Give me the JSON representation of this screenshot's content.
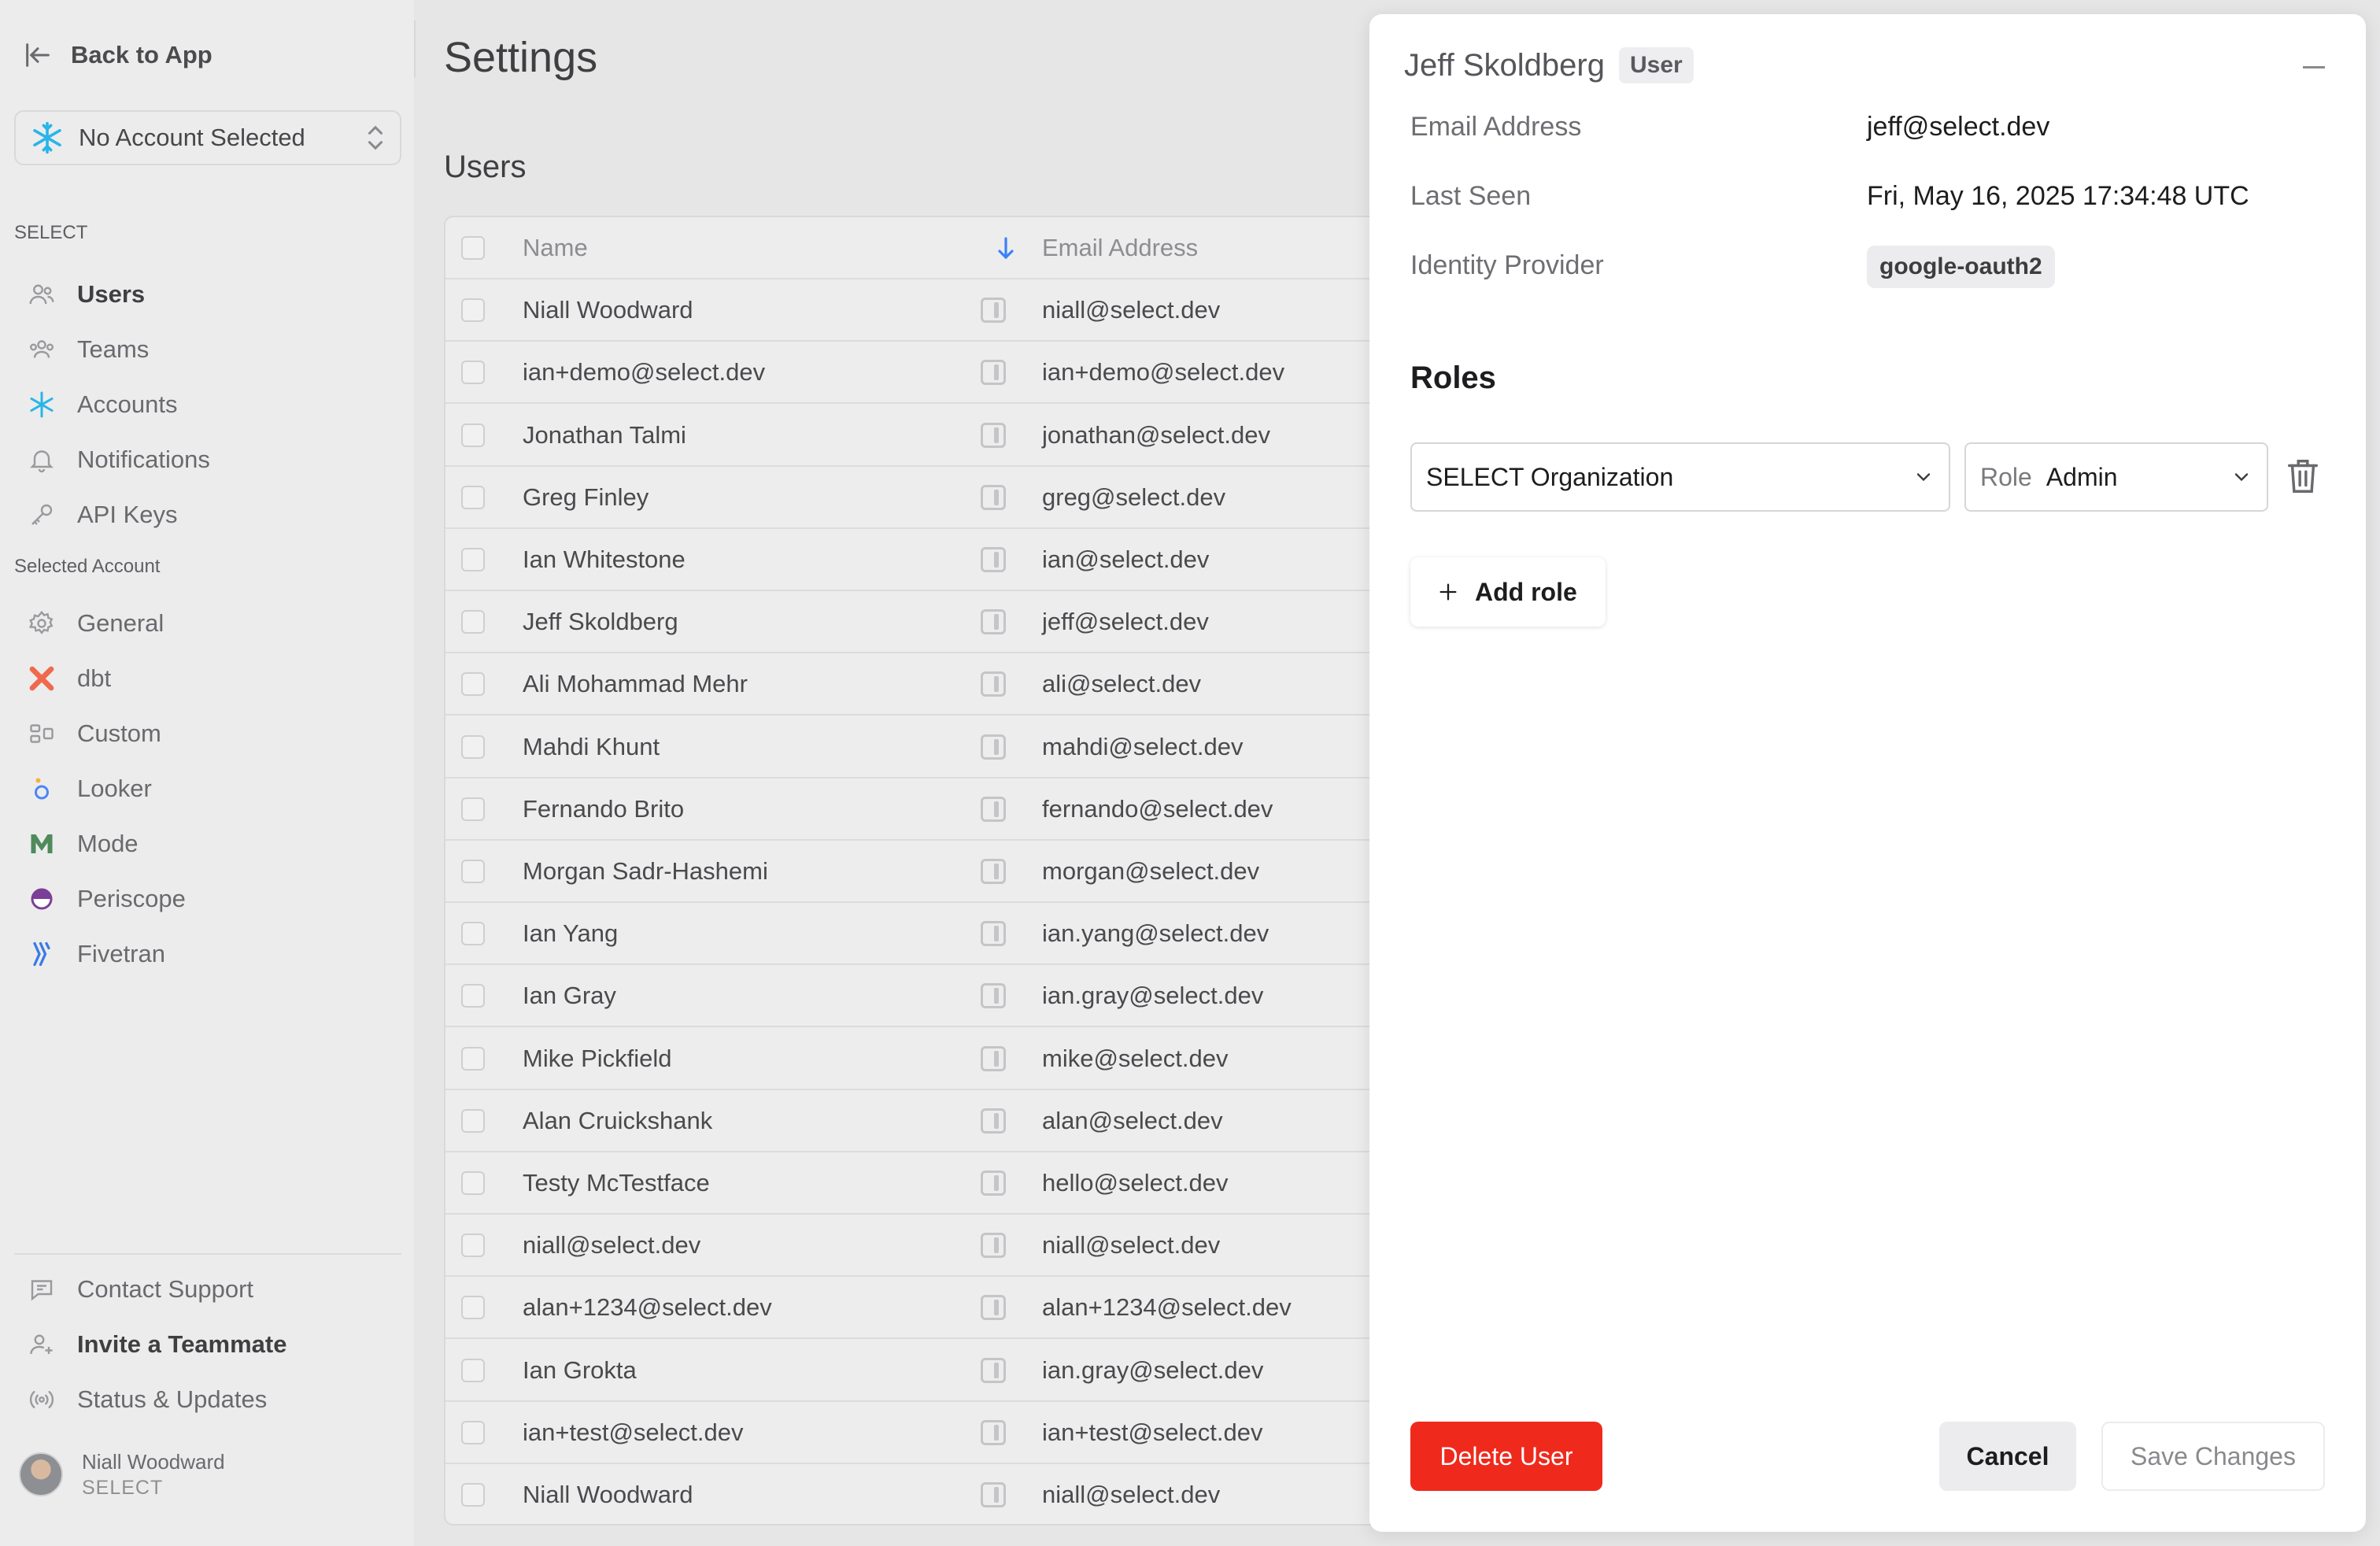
{
  "sidebar": {
    "back_label": "Back to App",
    "account_select": "No Account Selected",
    "section_select": "SELECT",
    "section_account": "Selected Account",
    "select_items": [
      {
        "label": "Users",
        "icon": "users-icon"
      },
      {
        "label": "Teams",
        "icon": "teams-icon"
      },
      {
        "label": "Accounts",
        "icon": "snowflake-icon"
      },
      {
        "label": "Notifications",
        "icon": "bell-icon"
      },
      {
        "label": "API Keys",
        "icon": "key-icon"
      }
    ],
    "account_items": [
      {
        "label": "General",
        "icon": "gear-icon"
      },
      {
        "label": "dbt",
        "icon": "dbt-icon"
      },
      {
        "label": "Custom",
        "icon": "custom-icon"
      },
      {
        "label": "Looker",
        "icon": "looker-icon"
      },
      {
        "label": "Mode",
        "icon": "mode-icon"
      },
      {
        "label": "Periscope",
        "icon": "periscope-icon"
      },
      {
        "label": "Fivetran",
        "icon": "fivetran-icon"
      }
    ],
    "footer_items": [
      {
        "label": "Contact Support",
        "icon": "chat-icon"
      },
      {
        "label": "Invite a Teammate",
        "icon": "user-plus-icon"
      },
      {
        "label": "Status & Updates",
        "icon": "broadcast-icon"
      }
    ],
    "user": {
      "name": "Niall Woodward",
      "org": "SELECT"
    }
  },
  "main": {
    "title": "Settings",
    "section_title": "Users",
    "columns": [
      "Name",
      "Email Address"
    ],
    "users": [
      {
        "name": "Niall Woodward",
        "email": "niall@select.dev"
      },
      {
        "name": "ian+demo@select.dev",
        "email": "ian+demo@select.dev"
      },
      {
        "name": "Jonathan Talmi",
        "email": "jonathan@select.dev"
      },
      {
        "name": "Greg Finley",
        "email": "greg@select.dev"
      },
      {
        "name": "Ian Whitestone",
        "email": "ian@select.dev"
      },
      {
        "name": "Jeff Skoldberg",
        "email": "jeff@select.dev"
      },
      {
        "name": "Ali Mohammad Mehr",
        "email": "ali@select.dev"
      },
      {
        "name": "Mahdi Khunt",
        "email": "mahdi@select.dev"
      },
      {
        "name": "Fernando Brito",
        "email": "fernando@select.dev"
      },
      {
        "name": "Morgan Sadr-Hashemi",
        "email": "morgan@select.dev"
      },
      {
        "name": "Ian Yang",
        "email": "ian.yang@select.dev"
      },
      {
        "name": "Ian Gray",
        "email": "ian.gray@select.dev"
      },
      {
        "name": "Mike Pickfield",
        "email": "mike@select.dev"
      },
      {
        "name": "Alan Cruickshank",
        "email": "alan@select.dev"
      },
      {
        "name": "Testy McTestface",
        "email": "hello@select.dev"
      },
      {
        "name": "niall@select.dev",
        "email": "niall@select.dev"
      },
      {
        "name": "alan+1234@select.dev",
        "email": "alan+1234@select.dev"
      },
      {
        "name": "Ian Grokta",
        "email": "ian.gray@select.dev"
      },
      {
        "name": "ian+test@select.dev",
        "email": "ian+test@select.dev"
      },
      {
        "name": "Niall Woodward",
        "email": "niall@select.dev"
      }
    ]
  },
  "drawer": {
    "name": "Jeff Skoldberg",
    "badge": "User",
    "fields": [
      {
        "label": "Email Address",
        "value": "jeff@select.dev"
      },
      {
        "label": "Last Seen",
        "value": "Fri, May 16, 2025 17:34:48 UTC"
      },
      {
        "label": "Identity Provider",
        "value": "google-oauth2"
      }
    ],
    "roles_title": "Roles",
    "org_select": "SELECT Organization",
    "role_label": "Role",
    "role_value": "Admin",
    "add_role": "Add role",
    "delete_label": "Delete User",
    "cancel_label": "Cancel",
    "save_label": "Save Changes"
  },
  "colors": {
    "danger": "#ef2a1c",
    "sort_arrow": "#3b82f6",
    "snowflake": "#29b5e8"
  }
}
